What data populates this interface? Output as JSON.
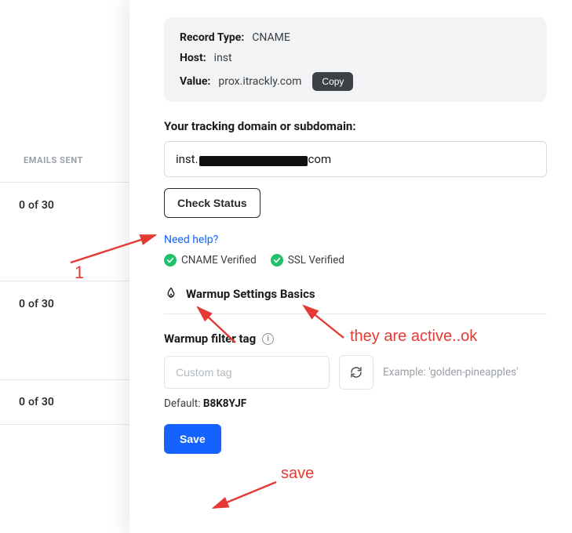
{
  "left": {
    "header": "EMAILS SENT",
    "rows": [
      {
        "sent": "0",
        "of": "of",
        "limit": "30"
      },
      {
        "sent": "0",
        "of": "of",
        "limit": "30"
      },
      {
        "sent": "0",
        "of": "of",
        "limit": "30"
      }
    ]
  },
  "dns": {
    "record_type_label": "Record Type:",
    "record_type_value": "CNAME",
    "host_label": "Host:",
    "host_value": "inst",
    "value_label": "Value:",
    "value_value": "prox.itrackly.com",
    "copy_label": "Copy"
  },
  "tracking": {
    "label": "Your tracking domain or subdomain:",
    "prefix": "inst.",
    "suffix": "com",
    "check_label": "Check Status"
  },
  "help_link": "Need help?",
  "verify": {
    "cname": "CNAME Verified",
    "ssl": "SSL Verified"
  },
  "warmup": {
    "heading": "Warmup Settings Basics",
    "filter_label": "Warmup filter tag",
    "placeholder": "Custom tag",
    "example": "Example: 'golden-pineapples'",
    "default_prefix": "Default: ",
    "default_code": "B8K8YJF",
    "save_label": "Save"
  },
  "annotations": {
    "one": "1",
    "active": "they are active..ok",
    "save": "save"
  }
}
